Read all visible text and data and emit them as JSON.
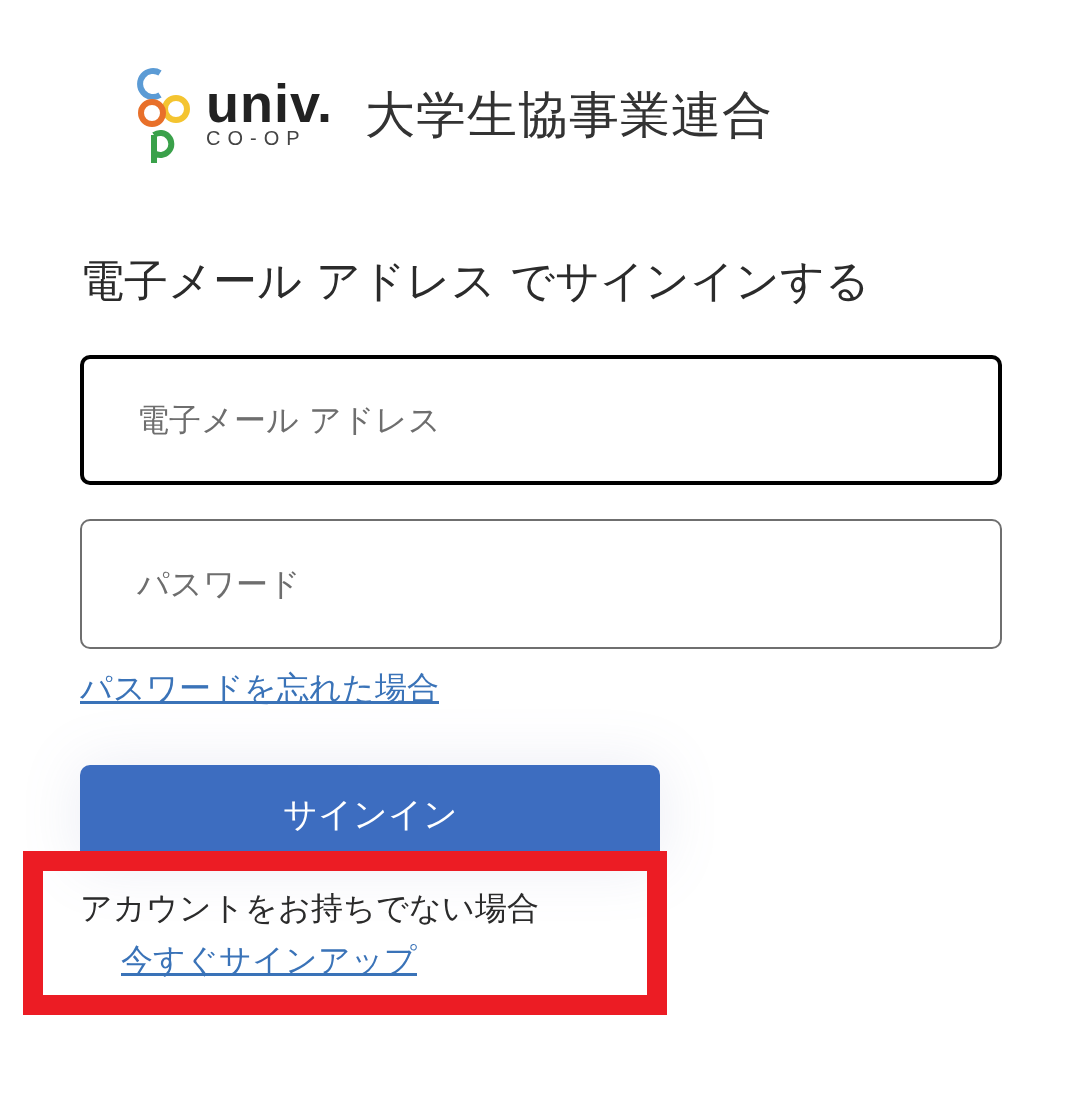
{
  "logo": {
    "brand": "univ.",
    "sub": "CO-OP",
    "name": "大学生協事業連合"
  },
  "heading": "電子メール アドレス でサインインする",
  "fields": [
    {
      "placeholder": "電子メール アドレス",
      "focused": true
    },
    {
      "placeholder": "パスワード",
      "focused": false
    }
  ],
  "forgot_link": "パスワードを忘れた場合",
  "signin_button": "サインイン",
  "signup": {
    "text": "アカウントをお持ちでない場合",
    "link": "今すぐサインアップ"
  },
  "highlight": {
    "color": "#ec1c24"
  }
}
